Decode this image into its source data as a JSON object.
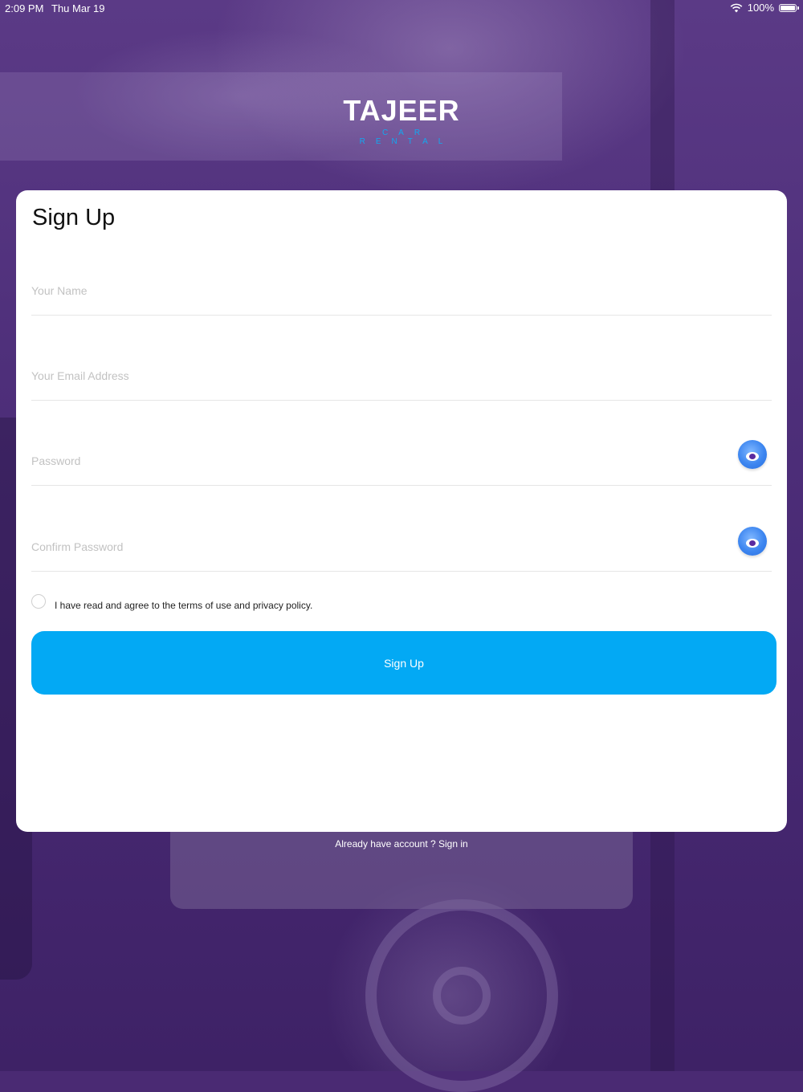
{
  "status_bar": {
    "time": "2:09 PM",
    "date": "Thu Mar 19",
    "battery": "100%"
  },
  "logo": {
    "title": "TAJEER",
    "subtitle": "CAR RENTAL"
  },
  "form": {
    "title": "Sign Up",
    "name_placeholder": "Your Name",
    "email_placeholder": "Your Email Address",
    "password_placeholder": "Password",
    "confirm_password_placeholder": "Confirm Password",
    "terms_text": "I have read and agree to the terms of use and privacy policy.",
    "terms_checked": false,
    "submit_label": "Sign Up"
  },
  "footer": {
    "signin_text": "Already have account ? Sign in"
  },
  "colors": {
    "accent": "#03a9f4",
    "background": "#4a2a73",
    "logo_subtitle": "#12a8f0"
  },
  "icons": [
    "wifi-icon",
    "battery-icon",
    "eye-icon"
  ]
}
